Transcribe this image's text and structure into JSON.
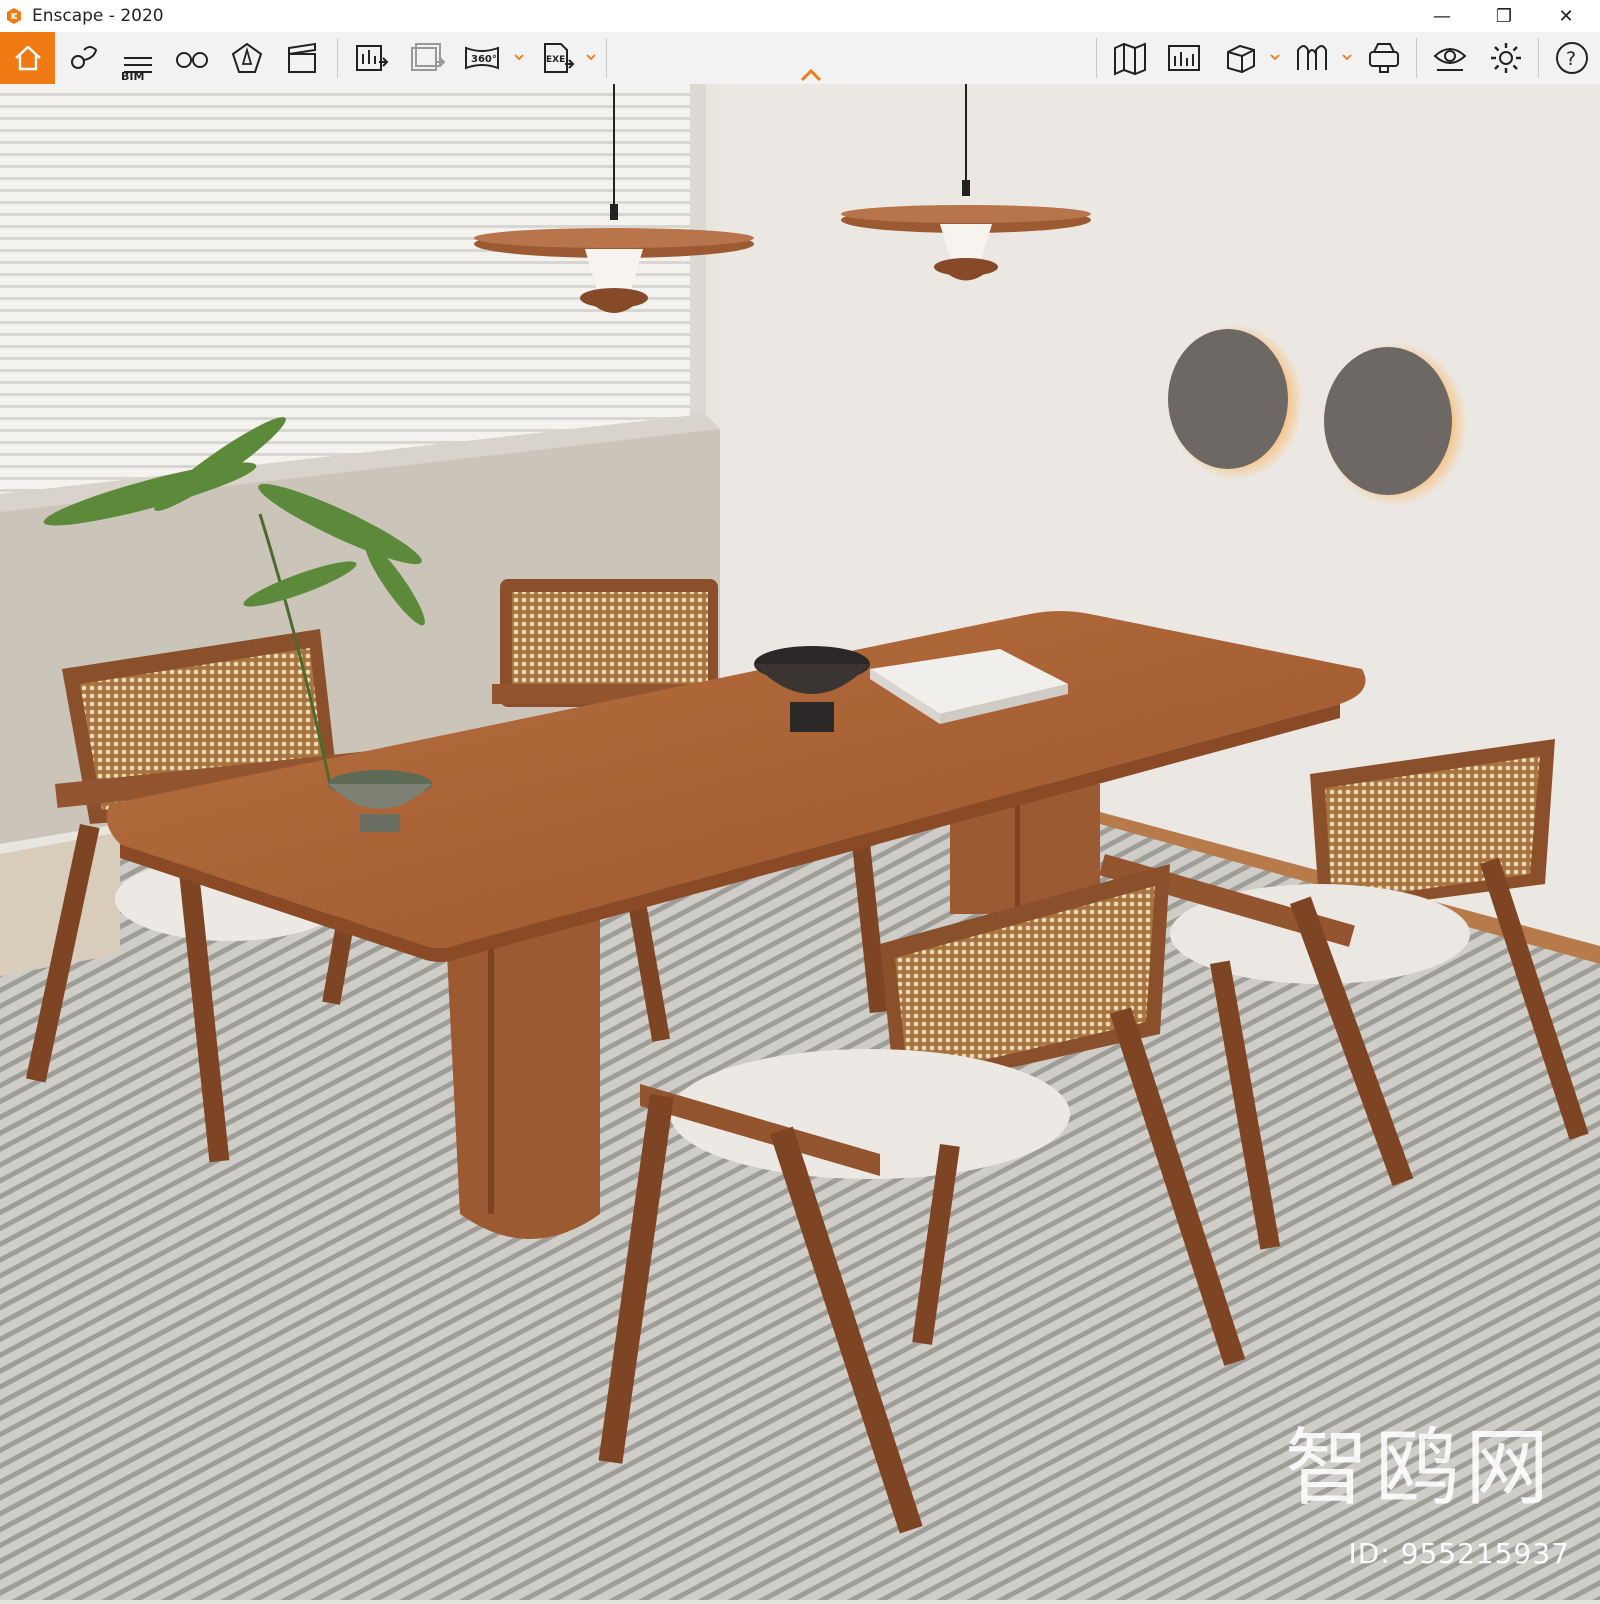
{
  "window": {
    "title": "Enscape - 2020",
    "minimize_glyph": "—",
    "restore_glyph": "❐",
    "close_glyph": "✕"
  },
  "toolbar": {
    "accent_color": "#f07a14",
    "left_group": [
      {
        "icon": "home-icon",
        "active": true
      },
      {
        "icon": "asset-library-icon"
      },
      {
        "icon": "bim-icon",
        "label": "BIM"
      },
      {
        "icon": "binoculars-icon"
      },
      {
        "icon": "light-view-icon"
      },
      {
        "icon": "video-editor-icon"
      },
      {
        "icon": "render-image-icon"
      },
      {
        "icon": "batch-render-icon"
      },
      {
        "icon": "panorama-360-icon",
        "label": "360°",
        "has_dropdown": true
      },
      {
        "icon": "export-exe-icon",
        "label": "EXE",
        "has_dropdown": true
      }
    ],
    "right_group": [
      {
        "icon": "map-icon"
      },
      {
        "icon": "screenshot-icon"
      },
      {
        "icon": "cube-view-icon",
        "has_dropdown": true
      },
      {
        "icon": "materials-icon",
        "has_dropdown": true
      },
      {
        "icon": "vr-headset-icon"
      },
      {
        "icon": "visual-settings-icon"
      },
      {
        "icon": "settings-gear-icon"
      },
      {
        "icon": "help-icon",
        "label": "?"
      }
    ]
  },
  "viewport": {
    "description_visible_text": "",
    "watermark_brand": "智鸥网",
    "watermark_id": "ID: 955215937",
    "colors": {
      "wall": "#e8e4de",
      "floor": "#c9c7c2",
      "wood": "#9c5a33",
      "blind": "#f4f3f1"
    }
  }
}
